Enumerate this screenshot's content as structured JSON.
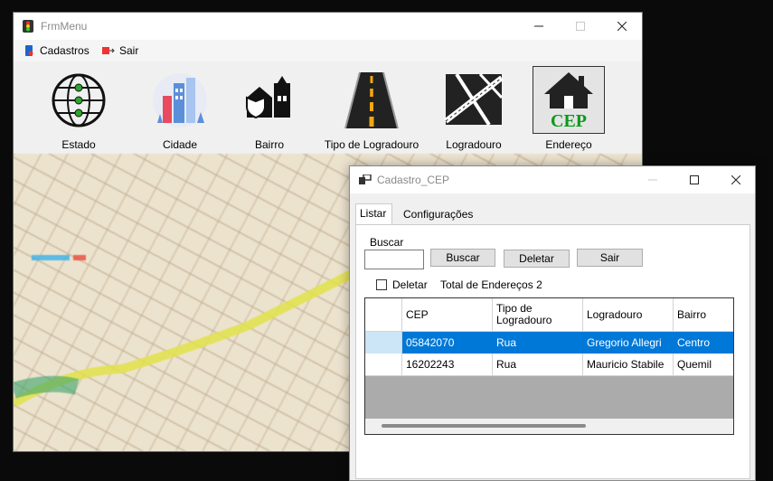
{
  "main_window": {
    "title": "FrmMenu",
    "menu": {
      "cadastros": "Cadastros",
      "sair": "Sair"
    },
    "toolbar": [
      {
        "label": "Estado",
        "icon": "globe-icon"
      },
      {
        "label": "Cidade",
        "icon": "city-buildings-icon"
      },
      {
        "label": "Bairro",
        "icon": "neighborhood-icon"
      },
      {
        "label": "Tipo de Logradouro",
        "icon": "road-icon"
      },
      {
        "label": "Logradouro",
        "icon": "street-map-icon"
      },
      {
        "label": "Endereço",
        "icon": "house-cep-icon",
        "badge": "CEP",
        "selected": true
      }
    ]
  },
  "cep_window": {
    "title": "Cadastro_CEP",
    "tabs": [
      "Listar",
      "Configurações"
    ],
    "active_tab": "Listar",
    "search_label": "Buscar",
    "search_value": "",
    "buttons": {
      "buscar": "Buscar",
      "deletar": "Deletar",
      "sair": "Sair"
    },
    "delete_checkbox": {
      "label": "Deletar",
      "checked": false
    },
    "total_label": "Total de Endereços 2",
    "grid": {
      "columns": [
        "CEP",
        "Tipo de\nLogradouro",
        "Logradouro",
        "Bairro"
      ],
      "rows": [
        [
          "05842070",
          "Rua",
          "Gregorio Allegri",
          "Centro"
        ],
        [
          "16202243",
          "Rua",
          "Mauricio Stabile",
          "Quemil"
        ]
      ],
      "selected_row": 0
    }
  },
  "colors": {
    "selection": "#0078d7",
    "cep_green": "#0a9a1a"
  }
}
